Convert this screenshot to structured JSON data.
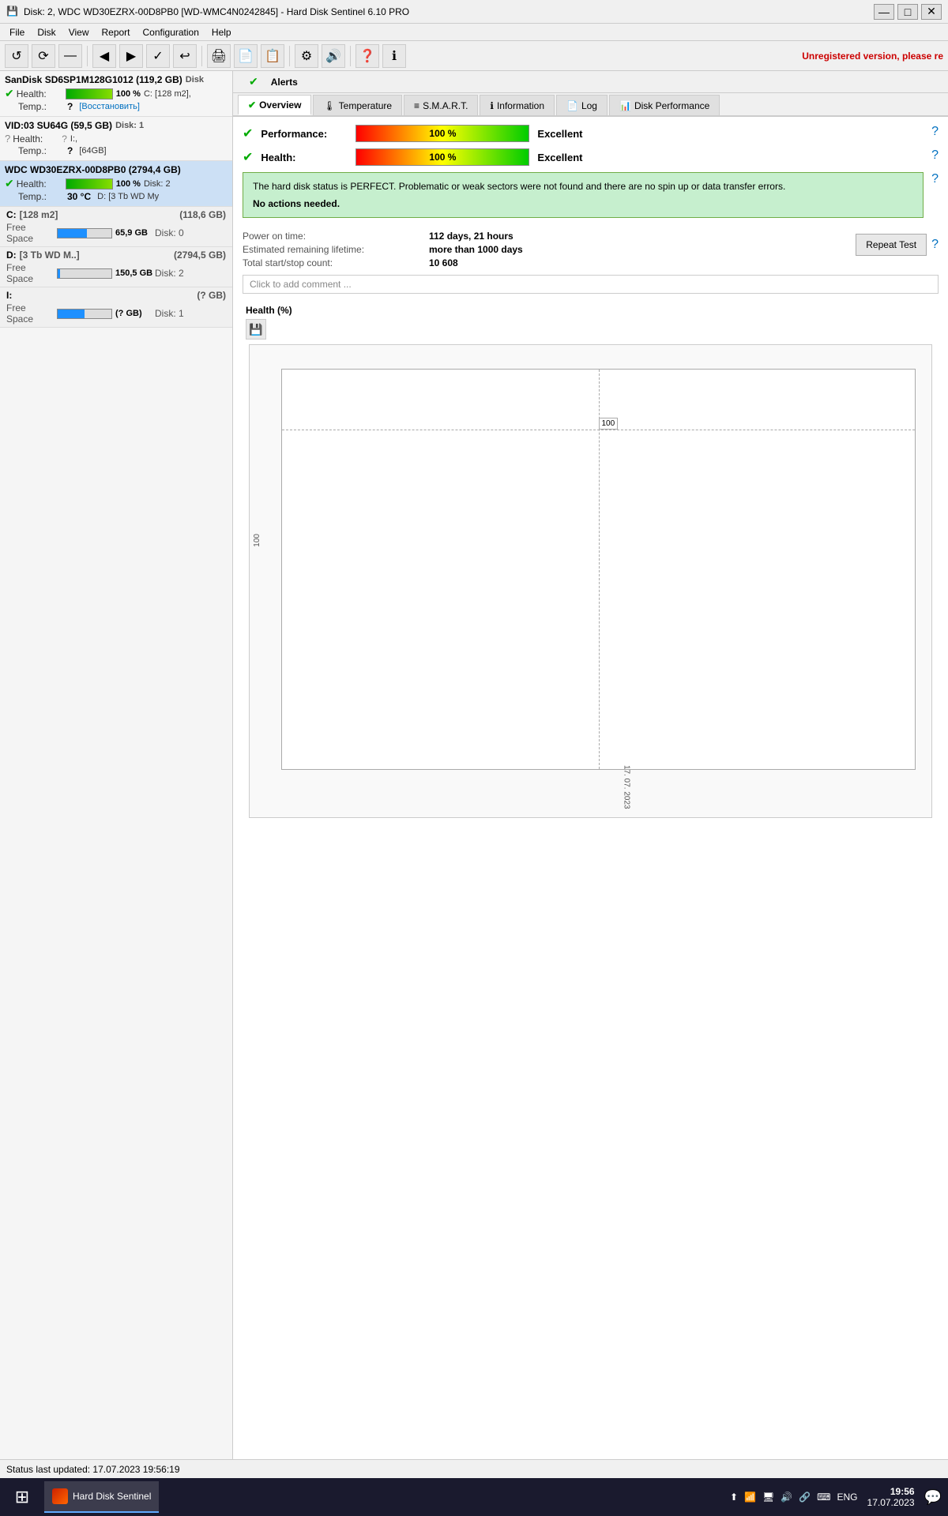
{
  "titleBar": {
    "title": "Disk: 2, WDC WD30EZRX-00D8PB0 [WD-WMC4N0242845]  -  Hard Disk Sentinel 6.10 PRO",
    "icon": "💾",
    "btnMinimize": "—",
    "btnMaximize": "□",
    "btnClose": "✕"
  },
  "menuBar": {
    "items": [
      "File",
      "Disk",
      "View",
      "Report",
      "Configuration",
      "Help"
    ]
  },
  "toolbar": {
    "buttons": [
      "↺",
      "⟳",
      "—",
      "◀",
      "▶",
      "✓",
      "↩",
      "🖨",
      "📄",
      "📋",
      "⚙",
      "🔊",
      "❓",
      "ℹ"
    ],
    "unregistered": "Unregistered version, please re"
  },
  "alerts": {
    "checkIcon": "✓",
    "label": "Alerts"
  },
  "tabs": [
    {
      "id": "overview",
      "label": "Overview",
      "icon": "✓",
      "active": true
    },
    {
      "id": "temperature",
      "label": "Temperature",
      "icon": "🌡"
    },
    {
      "id": "smart",
      "label": "S.M.A.R.T.",
      "icon": "≡"
    },
    {
      "id": "information",
      "label": "Information",
      "icon": "ℹ"
    },
    {
      "id": "log",
      "label": "Log",
      "icon": "📄"
    },
    {
      "id": "diskperf",
      "label": "Disk Performance",
      "icon": "📊"
    }
  ],
  "overview": {
    "performance": {
      "label": "Performance:",
      "barText": "100 %",
      "value": "Excellent",
      "helpIcon": "?"
    },
    "health": {
      "label": "Health:",
      "barText": "100 %",
      "value": "Excellent",
      "helpIcon": "?"
    },
    "statusMessage": "The hard disk status is PERFECT. Problematic or weak sectors were not found and there are no spin up or data transfer errors.",
    "noActions": "No actions needed.",
    "powerOnTime": {
      "label": "Power on time:",
      "value": "112 days, 21 hours"
    },
    "estimatedLifetime": {
      "label": "Estimated remaining lifetime:",
      "value": "more than 1000 days"
    },
    "startStopCount": {
      "label": "Total start/stop count:",
      "value": "10 608"
    },
    "repeatButton": "Repeat Test",
    "helpIcon": "?",
    "commentPlaceholder": "Click to add comment ...",
    "chartTitle": "Health (%)",
    "chartSaveIcon": "💾",
    "chartYLabel": "100",
    "chartXLabel": "17. 07. 2023",
    "chartValueBox": "100"
  },
  "leftPanel": {
    "disks": [
      {
        "id": "sandisk",
        "header": "SanDisk SD6SP1M128G1012 (119,2 GB)",
        "diskNum": "Disk",
        "healthLabel": "Health:",
        "healthPercent": "100 %",
        "healthFill": 100,
        "driveRight": "C: [128 m2],",
        "tempLabel": "Temp.:",
        "tempValue": "?",
        "tempRight": "[Восстановить]",
        "hasCheck": true
      },
      {
        "id": "vid03",
        "header": "VID:03  SU64G (59,5 GB)",
        "diskNum": "Disk: 1",
        "healthLabel": "Health:",
        "healthPercent": "?",
        "healthFill": 0,
        "driveRight": "I:,",
        "tempLabel": "Temp.:",
        "tempValue": "?",
        "tempRight": "[64GB]",
        "hasCheck": false
      },
      {
        "id": "wdc",
        "header": "WDC WD30EZRX-00D8PB0 (2794,4 GB)",
        "diskNum": "",
        "healthLabel": "Health:",
        "healthPercent": "100 %",
        "healthFill": 100,
        "driveRight": "Disk: 2",
        "tempLabel": "Temp.:",
        "tempValue": "30 °C",
        "tempRight": "D: [3 Tb WD My",
        "hasCheck": true,
        "selected": true
      }
    ],
    "drives": [
      {
        "id": "c",
        "letter": "C:",
        "label": "[128 m2]",
        "totalSize": "(118,6 GB)",
        "freeLabel": "Free Space",
        "freeValue": "65,9 GB",
        "freeFill": 55,
        "diskNum": "Disk: 0"
      },
      {
        "id": "d",
        "letter": "D:",
        "label": "[3 Tb WD M..]",
        "totalSize": "(2794,5 GB)",
        "freeLabel": "Free Space",
        "freeValue": "150,5 GB",
        "freeFill": 5,
        "diskNum": "Disk: 2"
      },
      {
        "id": "i",
        "letter": "I:",
        "label": "",
        "totalSize": "(? GB)",
        "freeLabel": "Free Space",
        "freeValue": "(? GB)",
        "freeFill": 50,
        "diskNum": "Disk: 1"
      }
    ]
  },
  "statusBar": {
    "text": "Status last updated: 17.07.2023 19:56:19"
  },
  "taskbar": {
    "appLabel": "Hard Disk Sentinel",
    "systrayIcons": [
      "⬆",
      "📶",
      "🖥",
      "🔊",
      "🔗",
      "⌨",
      "ENG"
    ],
    "time": "19:56",
    "date": "17.07.2023",
    "notifIcon": "💬"
  }
}
